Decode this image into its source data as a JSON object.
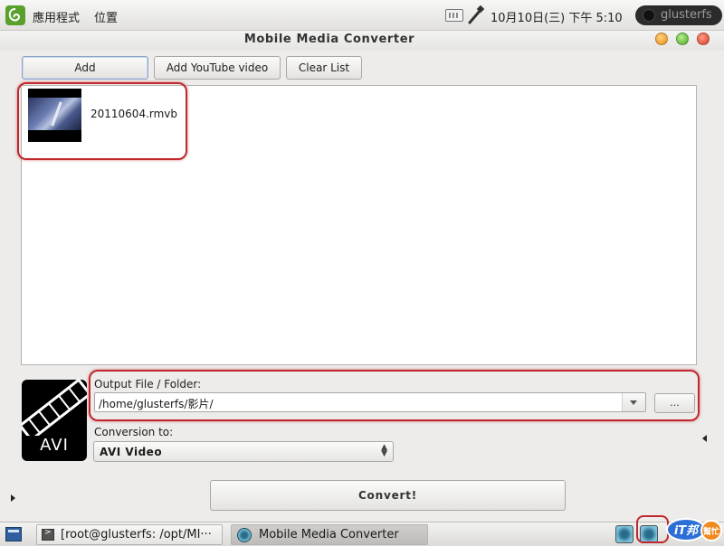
{
  "top_panel": {
    "applications_menu": "應用程式",
    "places_menu": "位置",
    "clock": "10月10日(三) 下午  5:10",
    "user_name": "glusterfs"
  },
  "window": {
    "title": "Mobile Media Converter"
  },
  "toolbar": {
    "add_label": "Add",
    "add_youtube_label": "Add YouTube video",
    "clear_list_label": "Clear List"
  },
  "file_list": {
    "items": [
      {
        "name": "20110604.rmvb"
      }
    ]
  },
  "format_icon": {
    "label": "AVI"
  },
  "output": {
    "label": "Output File / Folder:",
    "path": "/home/glusterfs/影片/",
    "browse_label": "..."
  },
  "conversion": {
    "label": "Conversion to:",
    "selected": "AVI Video"
  },
  "convert_label": "Convert!",
  "taskbar": {
    "tasks": [
      {
        "label": "[root@glusterfs: /opt/MI···"
      },
      {
        "label": "Mobile Media Converter"
      }
    ]
  },
  "watermark": {
    "text": "iT邦",
    "subtext": "幫忙"
  },
  "colors": {
    "annotation": "#c0282d",
    "menu_logo": "#5aa02c"
  }
}
